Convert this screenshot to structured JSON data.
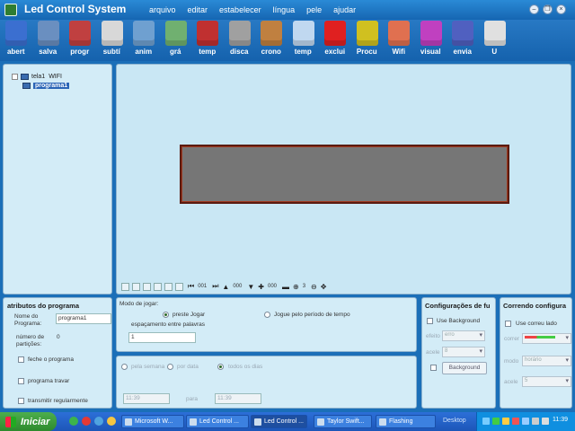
{
  "titlebar": {
    "title": "Led Control System"
  },
  "menu": [
    "arquivo",
    "editar",
    "estabelecer",
    "língua",
    "pele",
    "ajudar"
  ],
  "toolbar": [
    {
      "label": "abert",
      "icon": "folder-icon",
      "color": "#3b6fd0"
    },
    {
      "label": "salva",
      "icon": "save-icon",
      "color": "#6a8fc0"
    },
    {
      "label": "progr",
      "icon": "program-icon",
      "color": "#c04040"
    },
    {
      "label": "subtí",
      "icon": "subtitle-icon",
      "color": "#d8d8d8"
    },
    {
      "label": "anim",
      "icon": "animation-icon",
      "color": "#6fa0d0"
    },
    {
      "label": "grá",
      "icon": "image-icon",
      "color": "#70b070"
    },
    {
      "label": "temp",
      "icon": "calendar-icon",
      "color": "#c03030"
    },
    {
      "label": "disca",
      "icon": "clock-icon",
      "color": "#a0a0a0"
    },
    {
      "label": "crono",
      "icon": "hourglass-icon",
      "color": "#c08040"
    },
    {
      "label": "temp",
      "icon": "weather-icon",
      "color": "#c0d8f0"
    },
    {
      "label": "exclui",
      "icon": "delete-icon",
      "color": "#e02020"
    },
    {
      "label": "Procu",
      "icon": "search-icon",
      "color": "#d0c020"
    },
    {
      "label": "Wifi",
      "icon": "wifi-icon",
      "color": "#e07050"
    },
    {
      "label": "visual",
      "icon": "play-icon",
      "color": "#c040c0"
    },
    {
      "label": "envia",
      "icon": "send-icon",
      "color": "#5060c0"
    },
    {
      "label": "U",
      "icon": "usb-icon",
      "color": "#e0e0e0"
    }
  ],
  "tree": {
    "screen": "tela1",
    "screen_mode": "WIFI",
    "program": "programa1"
  },
  "canvas_controls": {
    "v1": "001",
    "v2": "000",
    "v3": "000",
    "v4": "3"
  },
  "attributes": {
    "title": "atributos do programa",
    "name_label": "Nome do Programa:",
    "name_value": "programa1",
    "partitions_label": "número de partições:",
    "partitions_value": "0",
    "lock_label": "feche o programa",
    "freeze_label": "programa travar",
    "regular_label": "transmitir regularmente"
  },
  "play_mode": {
    "title": "Modo de jogar:",
    "opt_play": "preste Jogar",
    "opt_period": "Jogue pelo período de tempo",
    "spacing_label": "espaçamento entre palavras",
    "spacing_value": "1"
  },
  "schedule": {
    "by_week": "pela semana",
    "by_date": "por data",
    "all_days": "todos os dias",
    "time_from": "11:39",
    "to_label": "para",
    "time_to": "11:39"
  },
  "config": {
    "title": "Configurações de fu",
    "use_bg": "Use Background",
    "effect_label": "efeito",
    "effect_value": "erro",
    "accel_label": "acele",
    "accel_value": "8",
    "bg_button": "Background"
  },
  "running": {
    "title": "Correndo configura",
    "use_border": "Use correu lado",
    "border_label": "correr",
    "mode_label": "modo",
    "mode_value": "horário",
    "speed_label": "acele",
    "speed_value": "5"
  },
  "taskbar": {
    "start": "Iniciar",
    "tasks": [
      "Microsoft W...",
      "Led Control ...",
      "Led Control ...",
      "Taylor Swift...",
      "Flashing"
    ],
    "desktop": "Desktop",
    "clock": "11:39"
  }
}
